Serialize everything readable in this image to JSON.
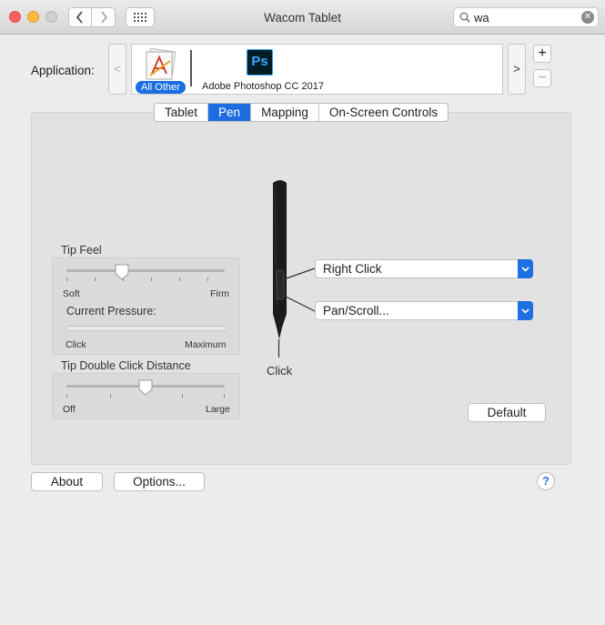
{
  "window": {
    "title": "Wacom Tablet"
  },
  "search": {
    "value": "wa",
    "clear_icon": "clear-icon"
  },
  "application": {
    "label": "Application:",
    "scroll_left": "<",
    "scroll_right": ">",
    "apps": [
      {
        "label": "All Other",
        "icon": "all-other-icon",
        "selected": true
      },
      {
        "label": "Adobe Photoshop CC 2017",
        "icon": "photoshop-icon",
        "icon_text": "Ps"
      }
    ],
    "add": "+",
    "remove": "−"
  },
  "tabs": [
    {
      "label": "Tablet"
    },
    {
      "label": "Pen",
      "active": true
    },
    {
      "label": "Mapping"
    },
    {
      "label": "On-Screen Controls"
    }
  ],
  "tip_feel": {
    "label": "Tip Feel",
    "min_label": "Soft",
    "max_label": "Firm",
    "level": 0.35,
    "pressure_label": "Current Pressure:",
    "pressure_min": "Click",
    "pressure_max": "Maximum",
    "pressure_level": 0
  },
  "double_click": {
    "label": "Tip Double Click Distance",
    "min_label": "Off",
    "max_label": "Large",
    "level": 0.5
  },
  "pen": {
    "upper_button": "Right Click",
    "lower_button": "Pan/Scroll...",
    "tip_label": "Click"
  },
  "buttons": {
    "default": "Default",
    "about": "About",
    "options": "Options...",
    "help": "?"
  },
  "colors": {
    "accent": "#1d6de0",
    "photoshop": "#31a8ff"
  }
}
